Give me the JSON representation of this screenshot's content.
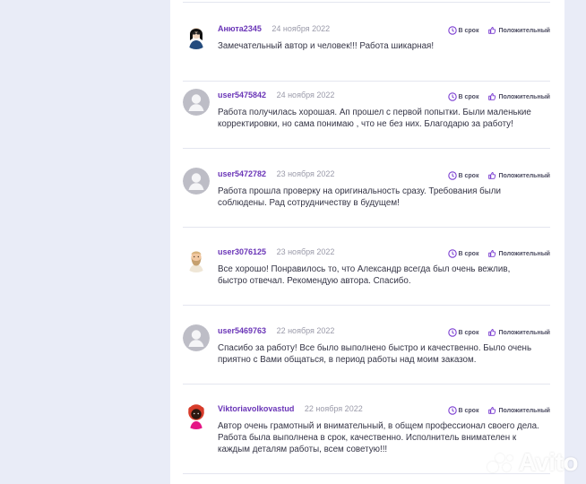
{
  "reviews": [
    {
      "username": "Анюта2345",
      "date": "24 ноября 2022",
      "on_time": "В срок",
      "rating": "Положительный",
      "text": "Замечательный автор и человек!!! Работа шикарная!"
    },
    {
      "username": "user5475842",
      "date": "24 ноября 2022",
      "on_time": "В срок",
      "rating": "Положительный",
      "text": "Работа получилась хорошая. Ап прошел с первой попытки. Были маленькие корректировки, но сама понимаю , что не без них. Благодарю за работу!"
    },
    {
      "username": "user5472782",
      "date": "23 ноября 2022",
      "on_time": "В срок",
      "rating": "Положительный",
      "text": "Работа прошла проверку на оригинальность сразу. Требования были соблюдены. Рад сотрудничеству в будущем!"
    },
    {
      "username": "user3076125",
      "date": "23 ноября 2022",
      "on_time": "В срок",
      "rating": "Положительный",
      "text": "Все хорошо! Понравилось то, что Александр всегда был очень вежлив, быстро отвечал. Рекомендую автора. Спасибо."
    },
    {
      "username": "user5469763",
      "date": "22 ноября 2022",
      "on_time": "В срок",
      "rating": "Положительный",
      "text": "Спасибо за работу! Все было выполнено быстро и качественно. Было очень приятно с Вами общаться, в период работы над моим заказом."
    },
    {
      "username": "Viktoriavolkovastud",
      "date": "22 ноября 2022",
      "on_time": "В срок",
      "rating": "Положительный",
      "text": "Автор очень грамотный и внимательный, в общем профессионал своего дела. Работа была выполнена в срок, качественно. Исполнитель внимателен к каждым деталям работы, всем советую!!!"
    }
  ],
  "watermark": {
    "brand": "Avito"
  },
  "colors": {
    "background": "#e9ecf7",
    "card": "#ffffff",
    "username": "#6a35b7",
    "badge_icon": "#7a3cd1",
    "text": "#353546"
  }
}
